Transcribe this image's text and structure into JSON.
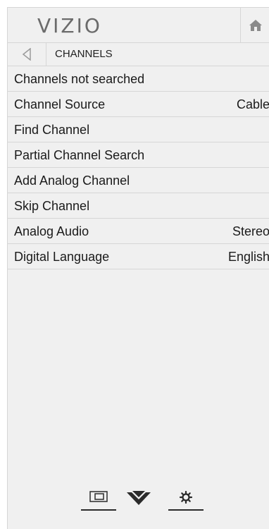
{
  "header": {
    "logo_text": "VIZIO",
    "home_icon": "home-icon"
  },
  "breadcrumb": {
    "back_icon": "triangle-left-icon",
    "title": "CHANNELS"
  },
  "menu": {
    "items": [
      {
        "label": "Channels not searched",
        "value": ""
      },
      {
        "label": "Channel Source",
        "value": "Cable"
      },
      {
        "label": "Find Channel",
        "value": ""
      },
      {
        "label": "Partial Channel Search",
        "value": ""
      },
      {
        "label": "Add Analog Channel",
        "value": ""
      },
      {
        "label": "Skip Channel",
        "value": ""
      },
      {
        "label": "Analog Audio",
        "value": "Stereo"
      },
      {
        "label": "Digital Language",
        "value": "English"
      }
    ]
  },
  "bottom_nav": {
    "items": [
      "input-icon",
      "vizio-v-icon",
      "gear-icon"
    ]
  },
  "colors": {
    "panel_bg": "#f0f0f0",
    "divider": "#d6d6d6",
    "logo": "#6b6b6b",
    "text": "#1a1a1a"
  }
}
